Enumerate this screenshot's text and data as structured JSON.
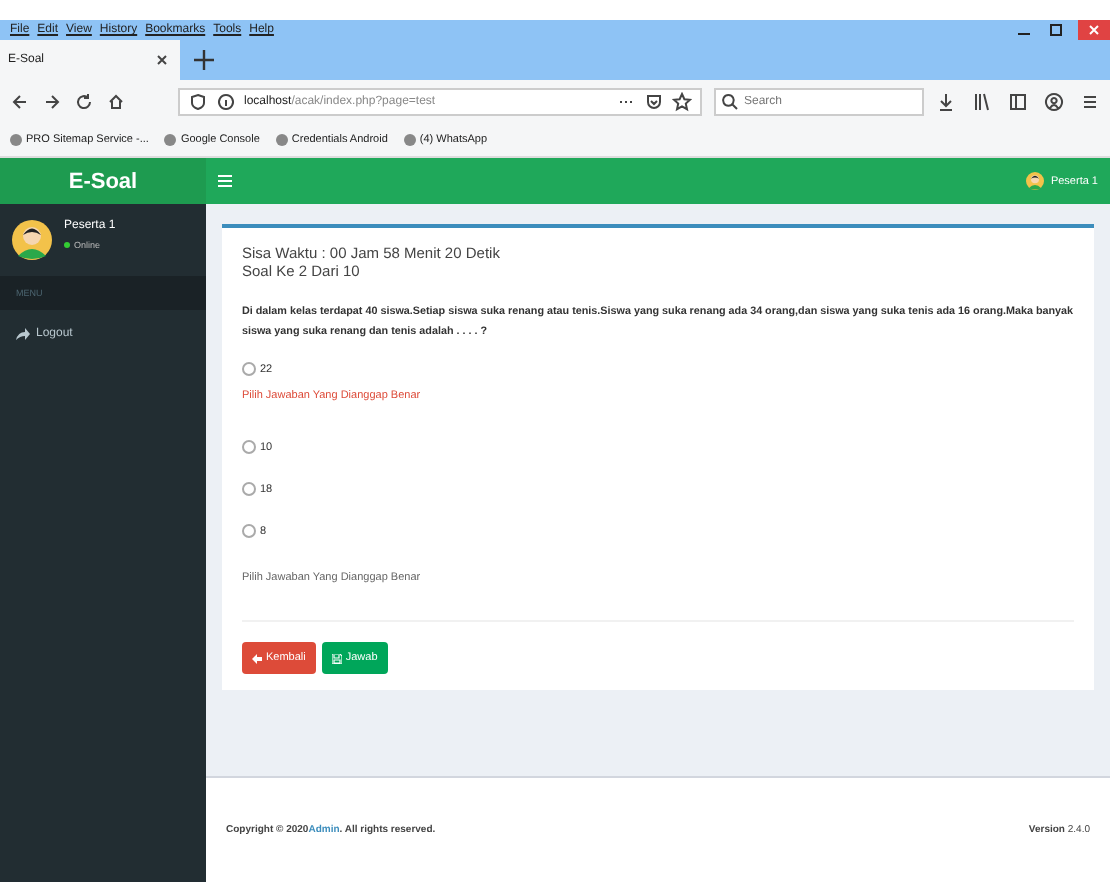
{
  "browser": {
    "menu": [
      "File",
      "Edit",
      "View",
      "History",
      "Bookmarks",
      "Tools",
      "Help"
    ],
    "tab": {
      "title": "E-Soal",
      "selected": true
    },
    "url_host": "localhost",
    "url_path": "/acak/index.php?page=test",
    "search": {
      "placeholder": "Search"
    },
    "bookmarks": [
      "PRO Sitemap Service -...",
      "Google Console",
      "Credentials Android",
      "(4) WhatsApp"
    ]
  },
  "app": {
    "brand": "E-Soal",
    "user": "Peserta 1",
    "status": "Online",
    "section": "MENU",
    "sidebar_items": [
      {
        "label": "Logout",
        "selected": false
      }
    ],
    "header_user": "Peserta 1"
  },
  "exam": {
    "timer": "Sisa Waktu : 00 Jam 58 Menit 20 Detik",
    "question_number": "Soal Ke 2 Dari 10",
    "question": "Di dalam kelas terdapat 40 siswa.Setiap siswa suka renang atau tenis.Siswa yang suka renang ada 34 orang,dan siswa yang suka tenis ada 16 orang.Maka banyak siswa yang suka renang dan tenis adalah . . . . ?",
    "items": [
      {
        "kind": "option",
        "label": "22",
        "selected": false
      },
      {
        "kind": "error",
        "text": "Pilih Jawaban Yang Dianggap Benar"
      },
      {
        "kind": "option",
        "label": "10",
        "selected": false
      },
      {
        "kind": "option",
        "label": "18",
        "selected": false
      },
      {
        "kind": "option",
        "label": "8",
        "selected": false
      },
      {
        "kind": "hint",
        "text": "Pilih Jawaban Yang Dianggap Benar"
      }
    ],
    "buttons": [
      {
        "kind": "back",
        "label": "Kembali"
      },
      {
        "kind": "submit",
        "label": "Jawab"
      }
    ]
  },
  "footer": {
    "prefix": "Copyright © 2020",
    "link": "Admin",
    "suffix": ". All rights reserved.",
    "version_label": "Version",
    "version": "2.4.0"
  }
}
